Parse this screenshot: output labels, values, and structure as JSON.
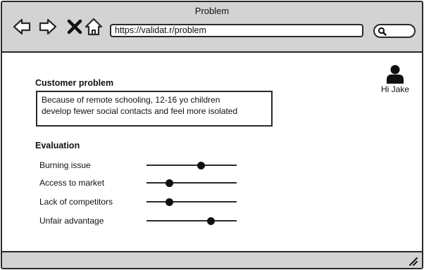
{
  "window": {
    "title": "Problem"
  },
  "toolbar": {
    "back_icon": "back-arrow-icon",
    "forward_icon": "forward-arrow-icon",
    "stop_icon": "close-icon",
    "home_icon": "home-icon",
    "address": "https://validat.r/problem",
    "search_icon": "search-icon"
  },
  "user": {
    "greeting": "Hi Jake",
    "icon": "user-icon"
  },
  "customer_problem": {
    "heading": "Customer problem",
    "lines": [
      "Because of remote schooling, 12-16 yo children",
      "develop fewer social contacts and feel more isolated"
    ]
  },
  "evaluation": {
    "heading": "Evaluation",
    "criteria": [
      {
        "label": "Burning issue",
        "level": 0.6
      },
      {
        "label": "Access to market",
        "level": 0.25
      },
      {
        "label": "Lack of competitors",
        "level": 0.25
      },
      {
        "label": "Unfair advantage",
        "level": 0.71
      }
    ]
  },
  "colors": {
    "chrome": "#d3d3d3",
    "outline": "#2a2a2a",
    "background": "#ffffff"
  }
}
